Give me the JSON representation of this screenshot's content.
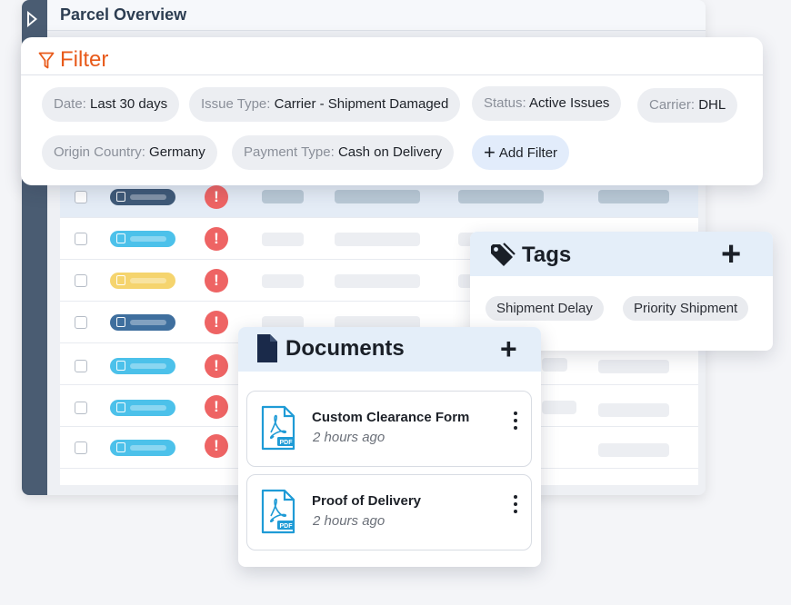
{
  "app": {
    "title": "Parcel Overview"
  },
  "filter": {
    "title": "Filter",
    "chips": [
      {
        "key": "Date:",
        "value": "Last 30 days"
      },
      {
        "key": "Issue Type:",
        "value": "Carrier - Shipment Damaged"
      },
      {
        "key": "Status:",
        "value": "Active Issues"
      },
      {
        "key": "Carrier:",
        "value": "DHL"
      },
      {
        "key": "Origin Country:",
        "value": "Germany"
      },
      {
        "key": "Payment Type:",
        "value": "Cash on Delivery"
      }
    ],
    "add_label": "Add Filter"
  },
  "tags": {
    "title": "Tags",
    "items": [
      "Shipment Delay",
      "Priority Shipment"
    ]
  },
  "documents": {
    "title": "Documents",
    "items": [
      {
        "name": "Custom Clearance Form",
        "time": "2 hours ago"
      },
      {
        "name": "Proof of Delivery",
        "time": "2 hours ago"
      }
    ]
  },
  "table": {
    "rows": [
      {
        "status_color": "#3f5a78",
        "selected": true
      },
      {
        "status_color": "#4cc1ea",
        "selected": false
      },
      {
        "status_color": "#f5d46e",
        "selected": false
      },
      {
        "status_color": "#3f6f9e",
        "selected": false
      },
      {
        "status_color": "#4cc1ea",
        "selected": false
      },
      {
        "status_color": "#4cc1ea",
        "selected": false
      },
      {
        "status_color": "#4cc1ea",
        "selected": false
      }
    ]
  },
  "colors": {
    "accent_filter": "#e85a1a",
    "alert_red": "#ee6464",
    "panel_header": "#e4eef9",
    "rail": "#4a5c72"
  },
  "icons": [
    "expand-rail-icon",
    "filter-icon",
    "plus-icon",
    "tag-icon",
    "document-icon",
    "pdf-icon",
    "kebab-menu-icon",
    "alert-icon"
  ]
}
